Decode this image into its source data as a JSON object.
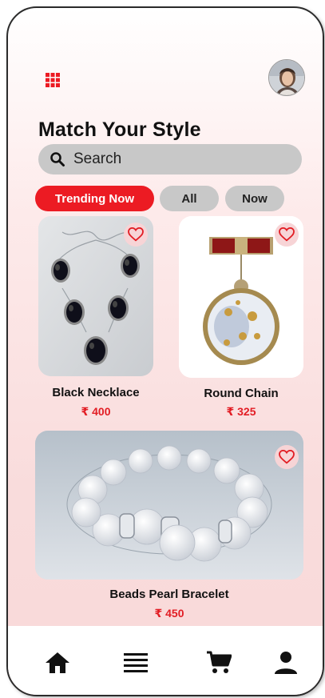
{
  "header": {
    "menu_icon": "grid-menu-icon",
    "avatar_icon": "user-avatar",
    "title": "Match Your Style"
  },
  "search": {
    "placeholder": "Search",
    "icon": "search-icon"
  },
  "tabs": [
    {
      "label": "Trending Now",
      "active": true
    },
    {
      "label": "All",
      "active": false
    },
    {
      "label": "Now",
      "active": false
    }
  ],
  "products": [
    {
      "name": "Black Necklace",
      "price": "₹ 400",
      "icon": "heart-icon"
    },
    {
      "name": "Round Chain",
      "price": "₹ 325",
      "icon": "heart-icon"
    },
    {
      "name": "Beads Pearl Bracelet",
      "price": "₹ 450",
      "icon": "heart-icon"
    }
  ],
  "bottom_nav": [
    {
      "icon": "home-icon"
    },
    {
      "icon": "list-icon"
    },
    {
      "icon": "cart-icon"
    },
    {
      "icon": "profile-icon"
    }
  ],
  "colors": {
    "accent": "#ec1b23",
    "price": "#e21d24",
    "chip": "#c8c8c8"
  }
}
